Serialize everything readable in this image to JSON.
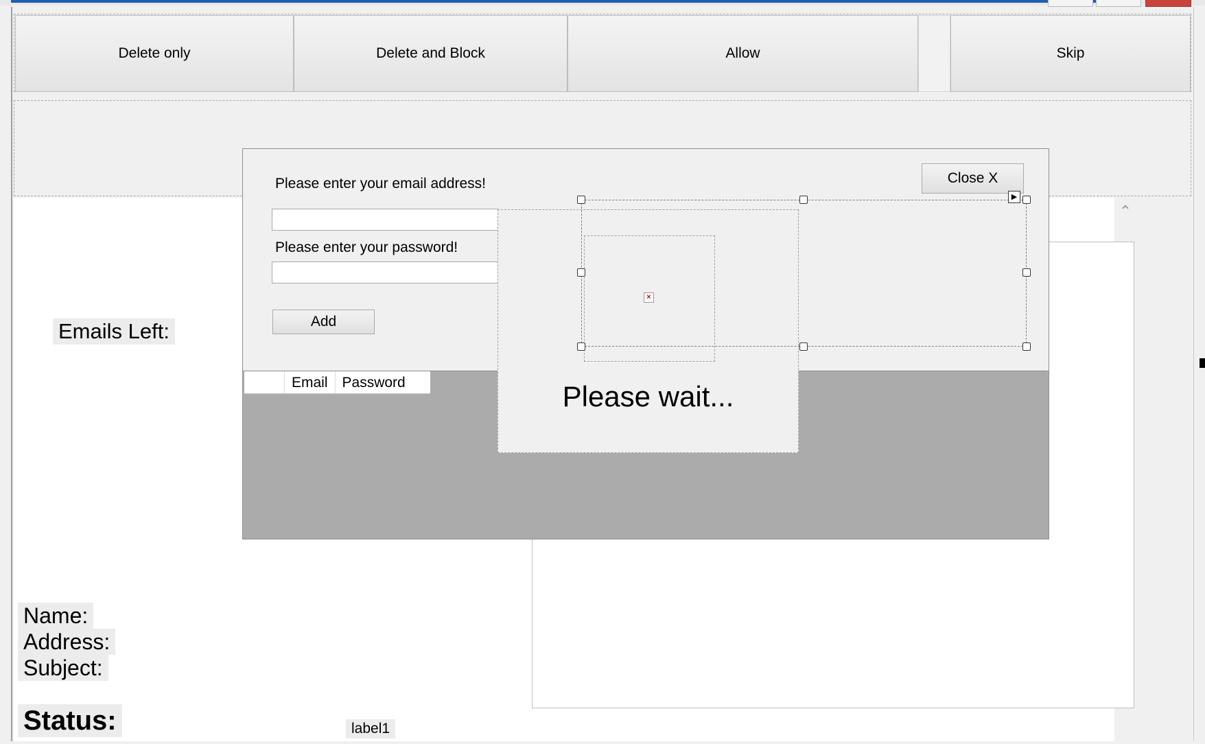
{
  "toolbar": {
    "delete_only": "Delete only",
    "delete_and_block": "Delete and Block",
    "allow": "Allow",
    "skip": "Skip"
  },
  "labels": {
    "emails_left": "Emails Left:",
    "name": "Name:",
    "address": "Address:",
    "subject": "Subject:",
    "status": "Status:",
    "label1": "label1"
  },
  "dialog": {
    "email_prompt": "Please enter your email address!",
    "password_prompt": "Please enter your password!",
    "email_value": "",
    "password_value": "",
    "add_button": "Add",
    "close_button": "Close X",
    "grid_columns": [
      "Email",
      "Password"
    ]
  },
  "wait": {
    "message": "Please wait..."
  },
  "icons": {
    "scroll_up": "chevron-up-icon",
    "broken_image": "broken-image-icon",
    "smart_tag": "smart-tag-arrow-icon"
  },
  "colors": {
    "window_background": "#f0f0f0",
    "grid_background": "#ababab",
    "title_accent": "#1f5fb4",
    "close_red": "#c8433c"
  }
}
